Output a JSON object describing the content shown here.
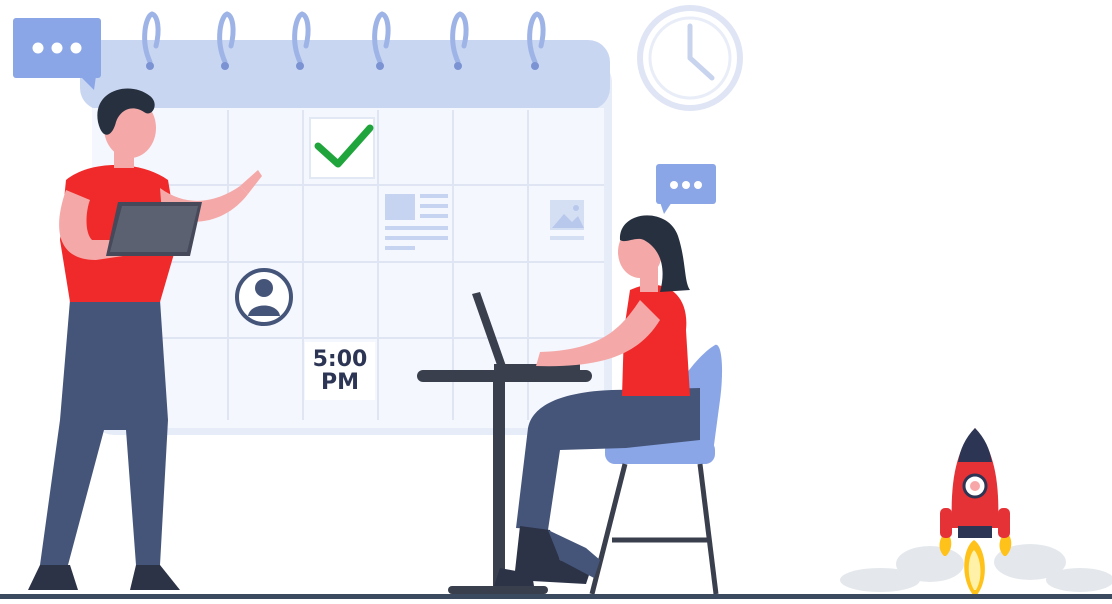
{
  "illustration": {
    "time_tag": {
      "time": "5:00",
      "period": "PM"
    },
    "icons": [
      "chat-bubble-icon",
      "clock-icon",
      "checkmark-icon",
      "document-icon",
      "image-icon",
      "user-avatar-icon",
      "rocket-icon"
    ],
    "colors": {
      "calendar": "#dde6f7",
      "calendar_header": "#c9d6f2",
      "accent_blue": "#8aa6e6",
      "shirt_red": "#f02a2a",
      "pants_navy": "#45557a",
      "check_green": "#1fa53b",
      "skin": "#f4a9a8",
      "text_dark": "#2c3554",
      "bar": "#3c4a5f"
    }
  }
}
